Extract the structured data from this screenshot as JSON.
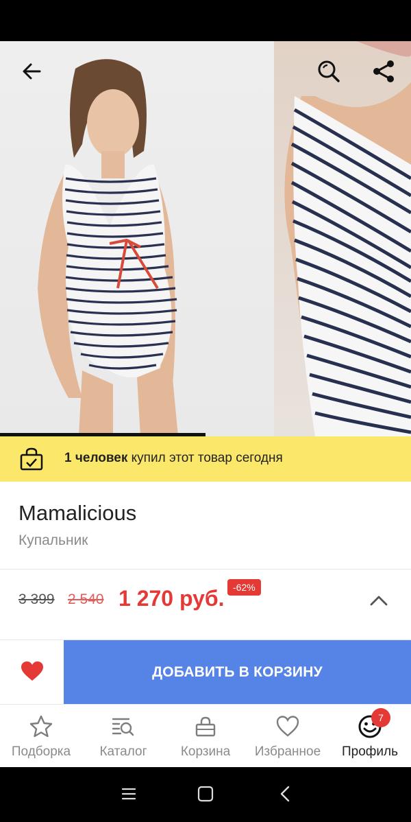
{
  "product": {
    "brand": "Mamalicious",
    "type": "Купальник"
  },
  "promo": {
    "bold": "1 человек",
    "rest": " купил этот товар сегодня"
  },
  "price": {
    "original": "3 399",
    "previous": "2 540",
    "current": "1 270 руб.",
    "discount": "-62%"
  },
  "actions": {
    "add_to_cart": "ДОБАВИТЬ В КОРЗИНУ"
  },
  "gallery": {
    "progress": 0.5
  },
  "nav": {
    "items": [
      {
        "label": "Подборка",
        "icon": "star-icon"
      },
      {
        "label": "Каталог",
        "icon": "catalog-search-icon"
      },
      {
        "label": "Корзина",
        "icon": "basket-icon"
      },
      {
        "label": "Избранное",
        "icon": "heart-outline-icon"
      },
      {
        "label": "Профиль",
        "icon": "smiley-icon"
      }
    ],
    "profile_badge": "7"
  },
  "colors": {
    "accent_blue": "#5684e6",
    "price_red": "#e53935",
    "promo_yellow": "#fbe86a"
  }
}
